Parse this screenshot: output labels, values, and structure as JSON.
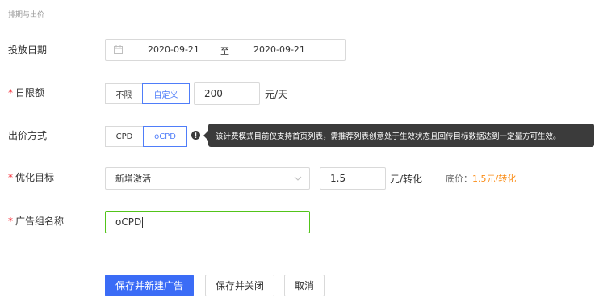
{
  "section_title": "排期与出价",
  "schedule": {
    "label": "投放日期",
    "start_date": "2020-09-21",
    "separator": "至",
    "end_date": "2020-09-21"
  },
  "daily_budget": {
    "required_mark": "*",
    "label": "日限额",
    "options": [
      "不限",
      "自定义"
    ],
    "selected": "自定义",
    "value": "200",
    "unit": "元/天"
  },
  "bid_method": {
    "label": "出价方式",
    "options": [
      "CPD",
      "oCPD"
    ],
    "selected": "oCPD",
    "tooltip": "该计费模式目前仅支持首页列表，需推荐列表创意处于生效状态且回传目标数据达到一定量方可生效。"
  },
  "optimization_goal": {
    "required_mark": "*",
    "label": "优化目标",
    "selected": "新增激活",
    "bid_value": "1.5",
    "bid_unit": "元/转化",
    "floor_label": "底价：",
    "floor_price": "1.5",
    "floor_unit": "元/转化"
  },
  "ad_group_name": {
    "required_mark": "*",
    "label": "广告组名称",
    "value": "oCPD"
  },
  "actions": {
    "save_new": "保存并新建广告",
    "save_close": "保存并关闭",
    "cancel": "取消"
  },
  "colors": {
    "primary": "#3b6cf6",
    "active_border": "#4f7df9",
    "required": "#f5222d",
    "focus_border": "#52c41a",
    "floor_price": "#fa8c16",
    "tooltip_bg": "#3b3b3b"
  }
}
